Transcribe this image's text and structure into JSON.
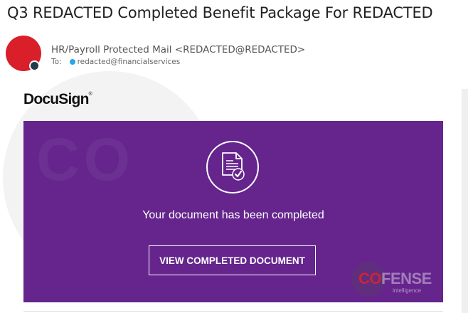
{
  "email": {
    "subject": "Q3 REDACTED Completed Benefit Package For REDACTED",
    "sender": "HR/Payroll Protected Mail <REDACTED@REDACTED>",
    "to_label": "To:",
    "recipient": "redacted@financialservices"
  },
  "body": {
    "brand": "DocuSign",
    "brand_mark": "®",
    "message": "Your document has been completed",
    "button_label": "VIEW COMPLETED DOCUMENT",
    "document_icon": "document-check-icon"
  },
  "watermark": {
    "banner_text": "CO",
    "logo_part1": "CO",
    "logo_part2": "FENSE",
    "logo_tag": "intelligence"
  },
  "colors": {
    "banner": "#65258d",
    "avatar": "#d81f2a",
    "presence": "#233a4c",
    "recipient_dot": "#2aa7e6"
  }
}
